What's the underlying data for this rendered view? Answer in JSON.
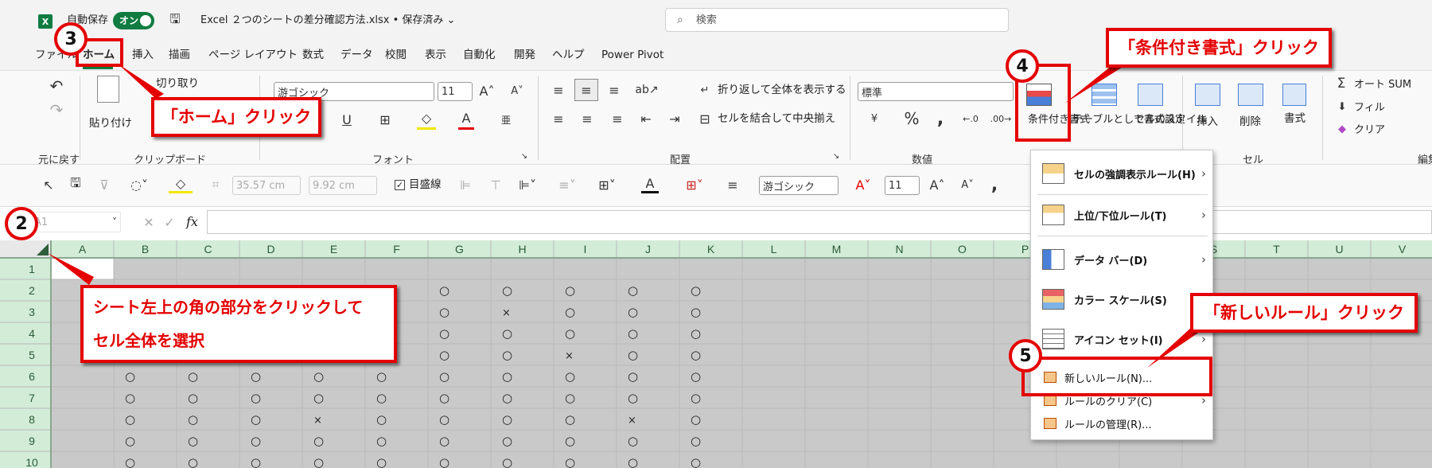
{
  "colors": {
    "excel_green": "#107c41",
    "annotation_red": "#e40000",
    "selection_grey": "#c9c9c9",
    "header_green": "#d2ecd8"
  },
  "title": {
    "autosave_label": "自動保存",
    "autosave_state": "オン",
    "doc_title": "Excel ２つのシートの差分確認方法.xlsx • 保存済み ⌄",
    "search_placeholder": "検索"
  },
  "tabs": [
    "ファイル",
    "ホーム",
    "挿入",
    "描画",
    "ページ レイアウト",
    "数式",
    "データ",
    "校閲",
    "表示",
    "自動化",
    "開発",
    "ヘルプ",
    "Power Pivot"
  ],
  "ribbon": {
    "undo_group": "元に戻す",
    "clipboard_group": "クリップボード",
    "font_group": "フォント",
    "align_group": "配置",
    "number_group": "数値",
    "cells_group": "セル",
    "edit_group": "編集",
    "cut": "切り取り",
    "paste": "貼り付け",
    "font_name": "游ゴシック",
    "font_size": "11",
    "wrap": "折り返して全体を表示する",
    "merge": "セルを結合して中央揃え",
    "number_format": "標準",
    "cond_format": "条件付き書式",
    "format_table": "テーブルとして書式設定",
    "cell_style": "セルのスタイル",
    "insert": "挿入",
    "delete": "削除",
    "format": "書式",
    "autosum": "オート SUM",
    "fill": "フィル",
    "clear": "クリア"
  },
  "qat": {
    "width": "35.57 cm",
    "height": "9.92 cm",
    "gridlines": "目盛線",
    "font_name": "游ゴシック",
    "font_size": "11"
  },
  "formula": {
    "name_box": "A1",
    "fx": "fx"
  },
  "grid": {
    "columns": [
      "A",
      "B",
      "C",
      "D",
      "E",
      "F",
      "G",
      "H",
      "I",
      "J",
      "K",
      "L",
      "M",
      "N",
      "O",
      "P",
      "Q",
      "R",
      "S",
      "T",
      "U",
      "V"
    ],
    "rows": [
      "1",
      "2",
      "3",
      "4",
      "5",
      "6",
      "7",
      "8",
      "9",
      "10"
    ],
    "cells": [
      [],
      [
        "",
        "",
        "",
        "",
        "",
        "",
        "○",
        "○",
        "○",
        "○",
        "○"
      ],
      [
        "",
        "",
        "",
        "",
        "",
        "",
        "○",
        "×",
        "○",
        "○",
        "○"
      ],
      [
        "",
        "",
        "",
        "",
        "",
        "",
        "○",
        "○",
        "○",
        "○",
        "○"
      ],
      [
        "",
        "",
        "",
        "",
        "",
        "",
        "○",
        "○",
        "×",
        "○",
        "○"
      ],
      [
        "",
        "○",
        "○",
        "○",
        "○",
        "○",
        "○",
        "○",
        "○",
        "○",
        "○"
      ],
      [
        "",
        "○",
        "○",
        "○",
        "○",
        "○",
        "○",
        "○",
        "○",
        "○",
        "○"
      ],
      [
        "",
        "○",
        "○",
        "○",
        "×",
        "○",
        "○",
        "○",
        "○",
        "×",
        "○"
      ],
      [
        "",
        "○",
        "○",
        "○",
        "○",
        "○",
        "○",
        "○",
        "○",
        "○",
        "○"
      ],
      [
        "",
        "○",
        "○",
        "○",
        "○",
        "○",
        "○",
        "○",
        "○",
        "○",
        "○"
      ]
    ]
  },
  "menu": {
    "highlight": "セルの強調表示ルール(H)",
    "topbottom": "上位/下位ルール(T)",
    "databar": "データ バー(D)",
    "colorscale": "カラー スケール(S)",
    "iconset": "アイコン セット(I)",
    "newrule": "新しいルール(N)...",
    "clearrules": "ルールのクリア(C)",
    "managerules": "ルールの管理(R)..."
  },
  "annotations": {
    "b2": "2",
    "b3": "3",
    "b4": "4",
    "b5": "5",
    "home": "「ホーム」クリック",
    "cond": "「条件付き書式」クリック",
    "newrule": "「新しいルール」クリック",
    "sheet_line1": "シート左上の角の部分をクリックして",
    "sheet_line2": "セル全体を選択"
  }
}
